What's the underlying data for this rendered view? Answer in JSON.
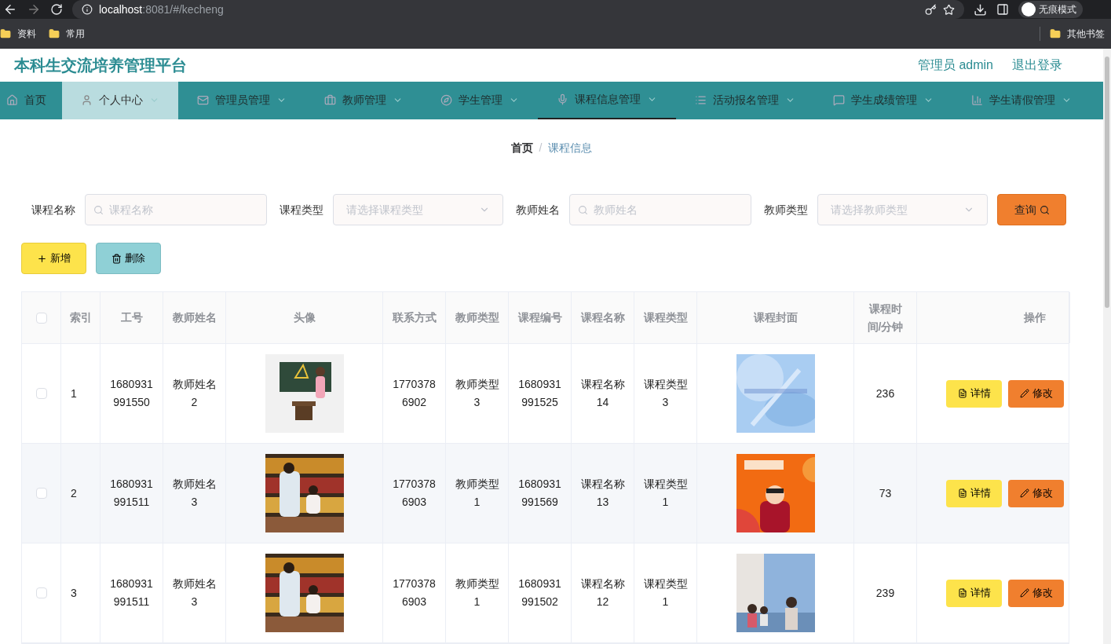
{
  "browser": {
    "url_host": "localhost",
    "url_path": ":8081/#/kecheng",
    "profile": "无痕模式",
    "bookmarks": [
      "资料",
      "常用"
    ],
    "other_bookmarks": "其他书签"
  },
  "header": {
    "title": "本科生交流培养管理平台",
    "user": "管理员 admin",
    "logout": "退出登录"
  },
  "nav": [
    {
      "label": "首页",
      "caret": false,
      "highlighted": false,
      "selected": false
    },
    {
      "label": "个人中心",
      "caret": true,
      "highlighted": true,
      "selected": false
    },
    {
      "label": "管理员管理",
      "caret": true,
      "highlighted": false,
      "selected": false
    },
    {
      "label": "教师管理",
      "caret": true,
      "highlighted": false,
      "selected": false
    },
    {
      "label": "学生管理",
      "caret": true,
      "highlighted": false,
      "selected": false
    },
    {
      "label": "课程信息管理",
      "caret": true,
      "highlighted": false,
      "selected": true
    },
    {
      "label": "活动报名管理",
      "caret": true,
      "highlighted": false,
      "selected": false
    },
    {
      "label": "学生成绩管理",
      "caret": true,
      "highlighted": false,
      "selected": false
    },
    {
      "label": "学生请假管理",
      "caret": true,
      "highlighted": false,
      "selected": false
    }
  ],
  "breadcrumb": {
    "separator": "/",
    "items": [
      "首页",
      "课程信息"
    ]
  },
  "filters": [
    {
      "kind": "input",
      "label": "课程名称",
      "placeholder": "课程名称"
    },
    {
      "kind": "select",
      "label": "课程类型",
      "placeholder": "请选择课程类型"
    },
    {
      "kind": "input",
      "label": "教师姓名",
      "placeholder": "教师姓名"
    },
    {
      "kind": "select",
      "label": "教师类型",
      "placeholder": "请选择教师类型"
    }
  ],
  "search_button": "查询",
  "actions": [
    {
      "kind": "add",
      "label": "新增"
    },
    {
      "kind": "delete",
      "label": "删除"
    }
  ],
  "table": {
    "all_checked": false,
    "columns": [
      "索引",
      "工号",
      "教师姓名",
      "头像",
      "联系方式",
      "教师类型",
      "课程编号",
      "课程名称",
      "课程类型",
      "课程封面",
      "课程时间/分钟",
      "操作"
    ],
    "rows": [
      {
        "checked": false,
        "cells": [
          "1",
          "1680931991550",
          "教师姓名2",
          {
            "kind": "picture"
          },
          "17703786902",
          "教师类型3",
          "1680931991525",
          "课程名称14",
          "课程类型3",
          {
            "kind": "picture"
          },
          "236"
        ],
        "buttons": [
          "详情",
          "修改"
        ]
      },
      {
        "checked": false,
        "cells": [
          "2",
          "1680931991511",
          "教师姓名3",
          {
            "kind": "picture"
          },
          "17703786903",
          "教师类型1",
          "1680931991569",
          "课程名称13",
          "课程类型1",
          {
            "kind": "picture"
          },
          "73"
        ],
        "buttons": [
          "详情",
          "修改"
        ]
      },
      {
        "checked": false,
        "cells": [
          "3",
          "1680931991511",
          "教师姓名3",
          {
            "kind": "picture"
          },
          "17703786903",
          "教师类型1",
          "1680931991502",
          "课程名称12",
          "课程类型1",
          {
            "kind": "picture"
          },
          "239"
        ],
        "buttons": [
          "详情",
          "修改"
        ]
      }
    ]
  }
}
